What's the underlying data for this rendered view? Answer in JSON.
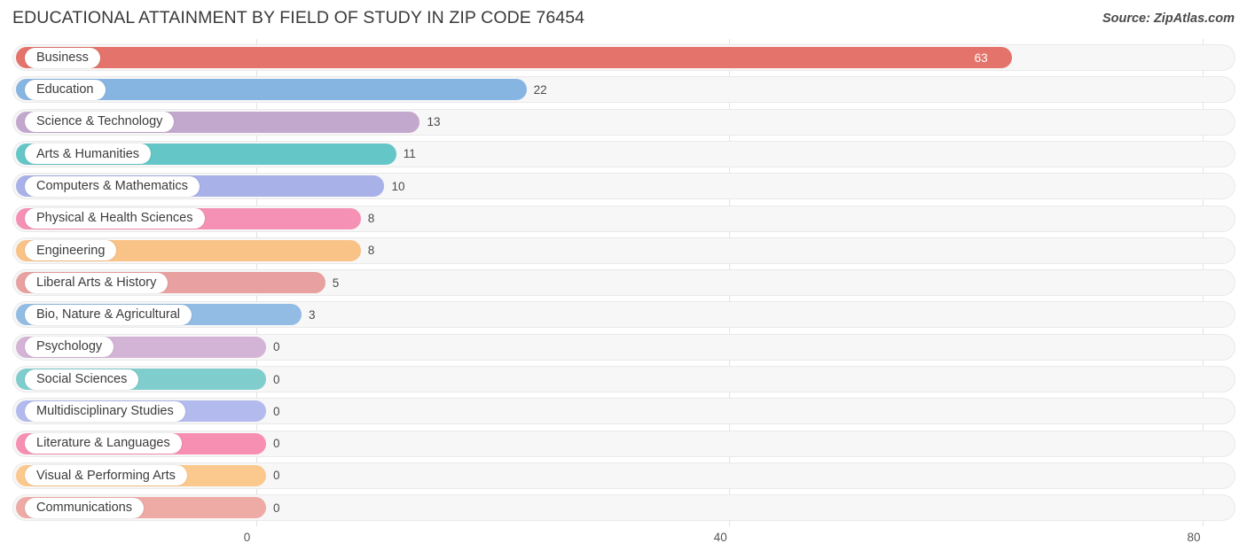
{
  "header": {
    "title": "EDUCATIONAL ATTAINMENT BY FIELD OF STUDY IN ZIP CODE 76454",
    "source": "Source: ZipAtlas.com"
  },
  "chart_data": {
    "type": "bar",
    "orientation": "horizontal",
    "title": "EDUCATIONAL ATTAINMENT BY FIELD OF STUDY IN ZIP CODE 76454",
    "xlabel": "",
    "ylabel": "",
    "xlim": [
      0,
      80
    ],
    "xticks": [
      "0",
      "40",
      "80"
    ],
    "xtick_values": [
      0,
      40,
      80
    ],
    "grid": true,
    "legend": false,
    "categories": [
      "Business",
      "Education",
      "Science & Technology",
      "Arts & Humanities",
      "Computers & Mathematics",
      "Physical & Health Sciences",
      "Engineering",
      "Liberal Arts & History",
      "Bio, Nature & Agricultural",
      "Psychology",
      "Social Sciences",
      "Multidisciplinary Studies",
      "Literature & Languages",
      "Visual & Performing Arts",
      "Communications"
    ],
    "values": [
      63,
      22,
      13,
      11,
      10,
      8,
      8,
      5,
      3,
      0,
      0,
      0,
      0,
      0,
      0
    ],
    "value_labels": [
      "63",
      "22",
      "13",
      "11",
      "10",
      "8",
      "8",
      "5",
      "3",
      "0",
      "0",
      "0",
      "0",
      "0",
      "0"
    ],
    "colors": [
      "#e4736b",
      "#87b5e2",
      "#c3a8cd",
      "#64c6c7",
      "#a8b1e8",
      "#f491b4",
      "#f9c286",
      "#e8a0a0",
      "#92bce3",
      "#d4b4d6",
      "#7fcdcd",
      "#b3bbee",
      "#f78fb3",
      "#fbc98d",
      "#eeaaa5"
    ]
  }
}
